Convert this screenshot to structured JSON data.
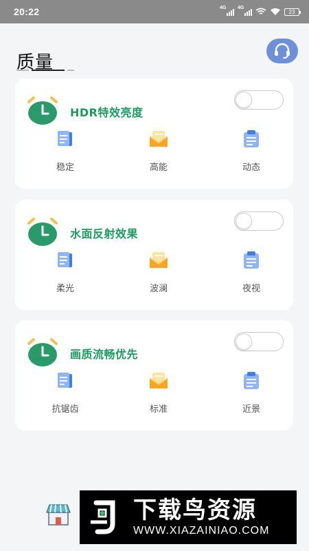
{
  "status_bar": {
    "time": "20:22",
    "network_1": "4G",
    "network_2": "4G",
    "battery": "23"
  },
  "page": {
    "title": "质量"
  },
  "colors": {
    "accent_green": "#1e9a60",
    "support_button": "#6e8fd9",
    "card_background": "#ffffff",
    "page_background": "#f4f5f7"
  },
  "cards": [
    {
      "title": "HDR特效亮度",
      "icon": "alarm-clock-icon",
      "toggle_on": false,
      "options": [
        {
          "label": "稳定",
          "icon": "document-blue-icon"
        },
        {
          "label": "高能",
          "icon": "envelope-orange-icon"
        },
        {
          "label": "动态",
          "icon": "clipboard-blue-icon"
        }
      ]
    },
    {
      "title": "水面反射效果",
      "icon": "alarm-clock-icon",
      "toggle_on": false,
      "options": [
        {
          "label": "柔光",
          "icon": "document-blue-icon"
        },
        {
          "label": "波澜",
          "icon": "envelope-orange-icon"
        },
        {
          "label": "夜视",
          "icon": "clipboard-blue-icon"
        }
      ]
    },
    {
      "title": "画质流畅优先",
      "icon": "alarm-clock-icon",
      "toggle_on": false,
      "options": [
        {
          "label": "抗锯齿",
          "icon": "document-blue-icon"
        },
        {
          "label": "标准",
          "icon": "envelope-orange-icon"
        },
        {
          "label": "近景",
          "icon": "clipboard-blue-icon"
        }
      ]
    }
  ],
  "bottom": {
    "store_icon": "store-icon"
  },
  "watermark": {
    "brand": "下载鸟资源",
    "url": "WWW.XIAZAINIAO.COM"
  }
}
